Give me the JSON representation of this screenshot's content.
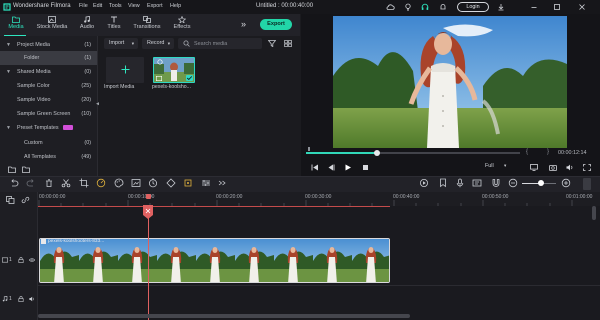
{
  "app": {
    "name": "Wondershare Filmora",
    "project_title": "Untitled : 00:00:40:00",
    "menu": [
      "File",
      "Edit",
      "Tools",
      "View",
      "Export",
      "Help"
    ],
    "login_label": "Login"
  },
  "tabs": [
    {
      "label": "Media",
      "icon": "folder-icon",
      "active": true
    },
    {
      "label": "Stock Media",
      "icon": "stock-media-icon",
      "active": false
    },
    {
      "label": "Audio",
      "icon": "music-note-icon",
      "active": false
    },
    {
      "label": "Titles",
      "icon": "titles-icon",
      "active": false
    },
    {
      "label": "Transitions",
      "icon": "transitions-icon",
      "active": false
    },
    {
      "label": "Effects",
      "icon": "effects-icon",
      "active": false
    }
  ],
  "export_label": "Export",
  "sidebar": {
    "items": [
      {
        "label": "Project Media",
        "count": "(1)",
        "expanded": true,
        "selected": false
      },
      {
        "label": "Folder",
        "count": "(1)",
        "selected": true
      },
      {
        "label": "Shared Media",
        "count": "(0)",
        "expanded": true,
        "selected": false
      },
      {
        "label": "Sample Color",
        "count": "(25)",
        "selected": false
      },
      {
        "label": "Sample Video",
        "count": "(20)",
        "selected": false
      },
      {
        "label": "Sample Green Screen",
        "count": "(10)",
        "selected": false
      },
      {
        "label": "Preset Templates",
        "count": "",
        "expanded": true,
        "selected": false,
        "badge": true
      },
      {
        "label": "Custom",
        "count": "(0)",
        "selected": false
      },
      {
        "label": "All Templates",
        "count": "(49)",
        "selected": false
      }
    ]
  },
  "media": {
    "import_dropdown": "Import",
    "record_dropdown": "Record",
    "search_placeholder": "Search media",
    "import_tile_label": "Import Media",
    "clip_tile_label": "pexels-koolsho..."
  },
  "preview": {
    "current_time": "00:00:12:14",
    "zoom_option": "Full",
    "progress": 0.33
  },
  "timeline": {
    "ruler_labels": [
      "00:00:00:00",
      "00:00:10:00",
      "00:00:20:00",
      "00:00:30:00",
      "00:00:40:00",
      "00:00:50:00",
      "00:01:00:00"
    ],
    "clip_title": "pexels-koolshooters-833...",
    "track_labels": [
      "1",
      "1"
    ]
  },
  "colors": {
    "accent": "#2ee6c0",
    "export_bg": "#22d6a8",
    "playhead": "#e06161",
    "panel": "#1e1e23"
  }
}
